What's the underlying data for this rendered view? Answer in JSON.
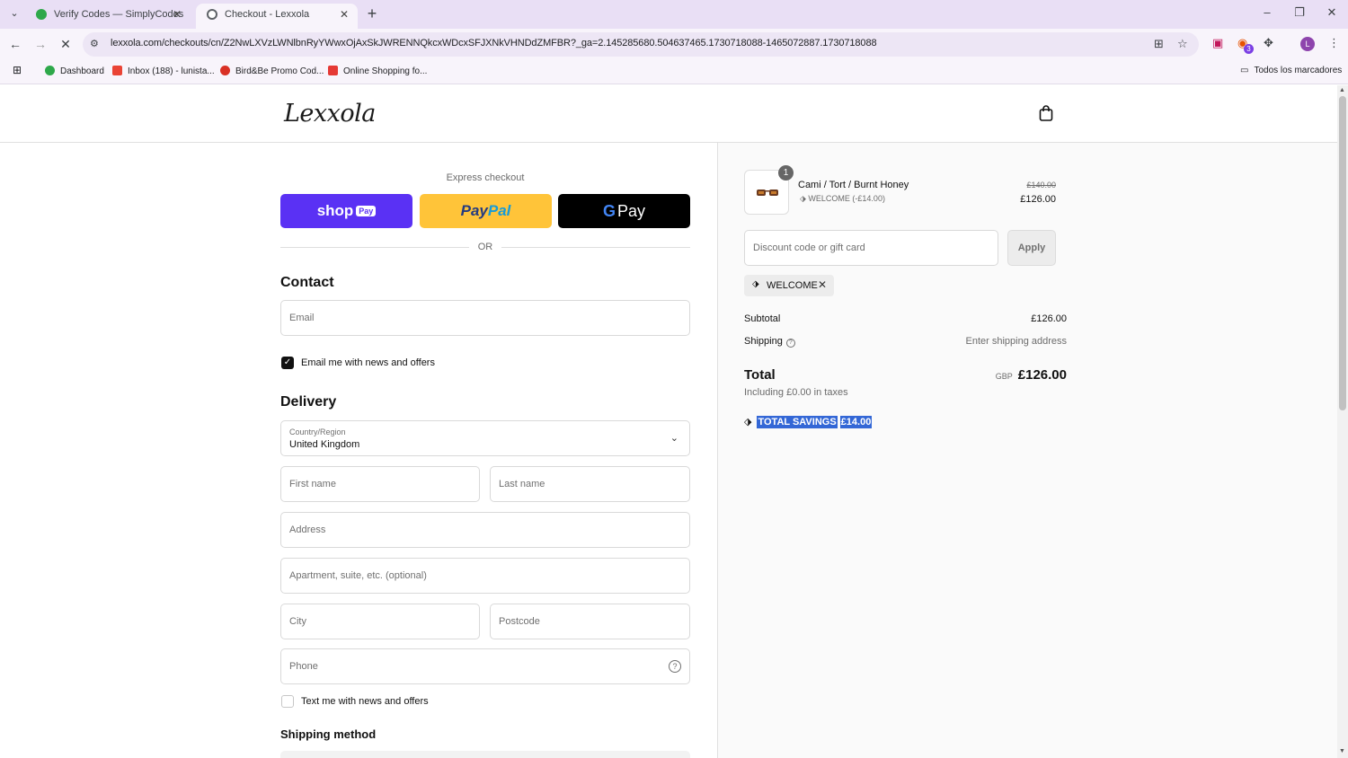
{
  "browser": {
    "tabs": [
      {
        "title": "Verify Codes — SimplyCodes"
      },
      {
        "title": "Checkout - Lexxola"
      }
    ],
    "url": "lexxola.com/checkouts/cn/Z2NwLXVzLWNlbnRyYWwxOjAxSkJWRENNQkcxWDcxSFJXNkVHNDdZMFBR?_ga=2.145285680.504637465.1730718088-1465072887.1730718088",
    "extension_badge": "3",
    "profile_initial": "L",
    "bookmarks": [
      {
        "label": "Dashboard",
        "color": "#2ea84a"
      },
      {
        "label": "Inbox (188) - lunista...",
        "color": "#ea4335"
      },
      {
        "label": "Bird&Be Promo Cod...",
        "color": "#d93025"
      },
      {
        "label": "Online Shopping fo...",
        "color": "#e53935"
      }
    ],
    "all_bookmarks_label": "Todos los marcadores"
  },
  "store": {
    "logo_text": "Lexxola"
  },
  "express": {
    "label": "Express checkout",
    "shop_pay": {
      "text": "shop",
      "tag": "Pay"
    },
    "paypal": {
      "part1": "Pay",
      "part2": "Pal"
    },
    "gpay": {
      "g": "G",
      "text": "Pay"
    },
    "or_text": "OR"
  },
  "contact": {
    "heading": "Contact",
    "email_placeholder": "Email",
    "news_checkbox_label": "Email me with news and offers",
    "news_checked": true
  },
  "delivery": {
    "heading": "Delivery",
    "country_label": "Country/Region",
    "country_value": "United Kingdom",
    "first_name_placeholder": "First name",
    "last_name_placeholder": "Last name",
    "address_placeholder": "Address",
    "apartment_placeholder": "Apartment, suite, etc. (optional)",
    "city_placeholder": "City",
    "postcode_placeholder": "Postcode",
    "phone_placeholder": "Phone",
    "text_checkbox_label": "Text me with news and offers",
    "text_checked": false
  },
  "shipping_method": {
    "heading": "Shipping method"
  },
  "summary": {
    "item": {
      "quantity": "1",
      "name": "Cami / Tort / Burnt Honey",
      "discount": "WELCOME (-£14.00)",
      "original_price": "£140.00",
      "price": "£126.00"
    },
    "discount_placeholder": "Discount code or gift card",
    "apply_label": "Apply",
    "applied_code": "WELCOME",
    "subtotal_label": "Subtotal",
    "subtotal_value": "£126.00",
    "shipping_label": "Shipping",
    "shipping_value": "Enter shipping address",
    "total_label": "Total",
    "total_currency": "GBP",
    "total_value": "£126.00",
    "taxes_text": "Including £0.00 in taxes",
    "savings_label": "TOTAL SAVINGS",
    "savings_value": "£14.00"
  }
}
